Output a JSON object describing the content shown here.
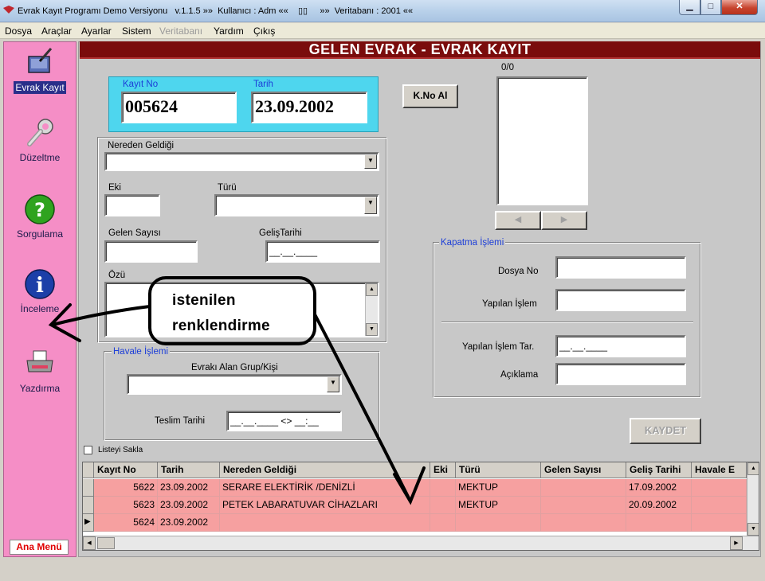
{
  "window": {
    "title": "Evrak Kayıt Programı Demo Versiyonu   v.1.1.5 »»  Kullanıcı : Adm ««    ▯▯     »»  Veritabanı : 2001 ««",
    "min_icon": "minimize-icon",
    "max_icon": "maximize-icon",
    "close_icon": "close-icon"
  },
  "menu": {
    "items": [
      "Dosya",
      "Araçlar",
      "Ayarlar",
      "Sistem",
      "Veritabanı",
      "Yardım",
      "Çıkış"
    ]
  },
  "sidebar": {
    "items": [
      {
        "label": "Evrak Kayıt",
        "icon": "document-pen-icon"
      },
      {
        "label": "Düzeltme",
        "icon": "wrench-icon"
      },
      {
        "label": "Sorgulama",
        "icon": "question-icon"
      },
      {
        "label": "İnceleme",
        "icon": "info-icon"
      },
      {
        "label": "Yazdırma",
        "icon": "printer-icon"
      }
    ],
    "ana_menu": "Ana Menü"
  },
  "header": {
    "title": "GELEN EVRAK - EVRAK KAYIT"
  },
  "form": {
    "kayit_no_label": "Kayıt No",
    "kayit_no": "005624",
    "tarih_label": "Tarih",
    "tarih": "23.09.2002",
    "kno_button": "K.No Al",
    "counter": "0/0",
    "nereden_label": "Nereden Geldiği",
    "eki_label": "Eki",
    "turu_label": "Türü",
    "gelen_sayisi_label": "Gelen Sayısı",
    "gelis_tarihi_label": "GelişTarihi",
    "gelis_tarihi_mask": "__.__.____",
    "ozu_label": "Özü",
    "havale_title": "Havale İşlemi",
    "alan_grup_label": "Evrakı Alan Grup/Kişi",
    "teslim_label": "Teslim Tarihi",
    "teslim_mask": "__.__.____ <> __:__",
    "kapatma_title": "Kapatma İşlemi",
    "dosya_no_label": "Dosya No",
    "yapilan_islem_label": "Yapılan İşlem",
    "yapilan_islem_tar_label": "Yapılan İşlem Tar.",
    "yapilan_islem_tar_mask": "__.__.____",
    "aciklama_label": "Açıklama",
    "kaydet_button": "KAYDET",
    "listeyi_sakla": "Listeyi Sakla",
    "nav_prev": "◀",
    "nav_next": "▶"
  },
  "grid": {
    "columns": [
      "Kayıt No",
      "Tarih",
      "Nereden Geldiği",
      "Eki",
      "Türü",
      "Gelen Sayısı",
      "Geliş Tarihi",
      "Havale E"
    ],
    "rows": [
      {
        "kayit_no": "5622",
        "tarih": "23.09.2002",
        "nereden": "SERARE ELEKTİRİK /DENİZLİ",
        "eki": "",
        "turu": "MEKTUP",
        "sayi": "",
        "gelis": "17.09.2002",
        "havale": ""
      },
      {
        "kayit_no": "5623",
        "tarih": "23.09.2002",
        "nereden": "PETEK LABARATUVAR  CİHAZLARI",
        "eki": "",
        "turu": "MEKTUP",
        "sayi": "",
        "gelis": "20.09.2002",
        "havale": ""
      },
      {
        "kayit_no": "5624",
        "tarih": "23.09.2002",
        "nereden": "",
        "eki": "",
        "turu": "",
        "sayi": "",
        "gelis": "",
        "havale": ""
      }
    ],
    "row_color": "#f6a0a0"
  },
  "annotation": {
    "line1": "istenilen",
    "line2": "renklendirme"
  }
}
